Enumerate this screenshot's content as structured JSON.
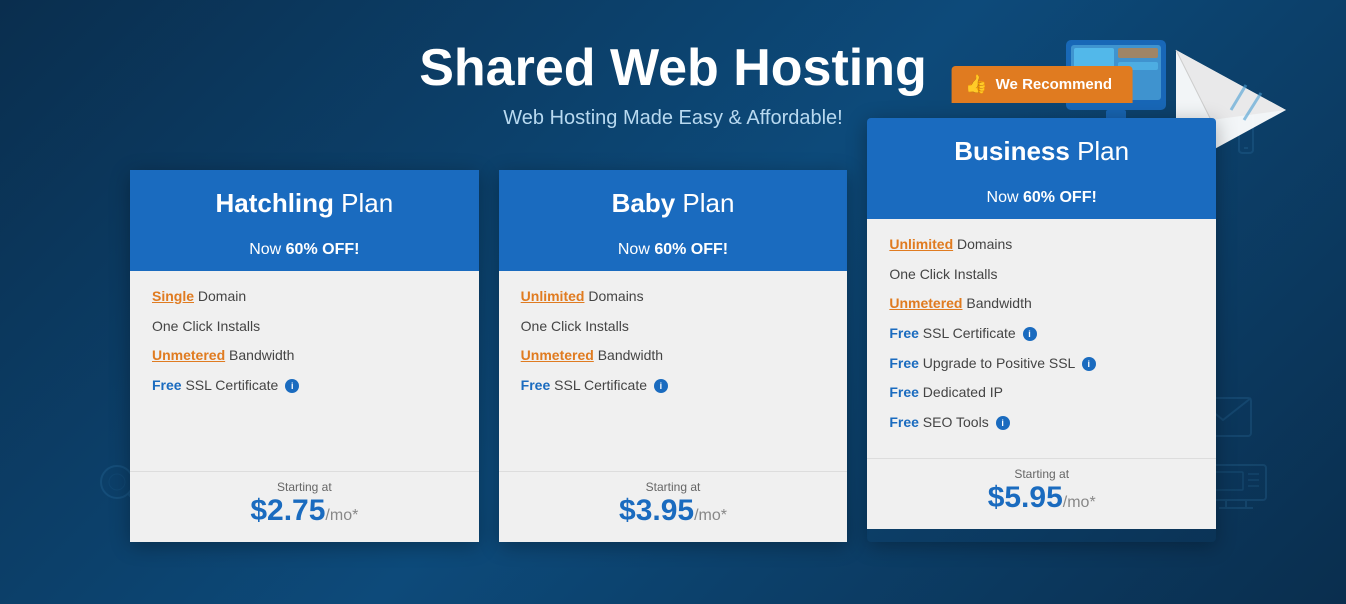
{
  "page": {
    "title": "Shared Web Hosting",
    "subtitle": "Web Hosting Made Easy & Affordable!"
  },
  "plans": [
    {
      "id": "hatchling",
      "name_bold": "Hatchling",
      "name_rest": " Plan",
      "discount_label": "Now ",
      "discount_value": "60% OFF!",
      "features": [
        {
          "highlight": "Single",
          "highlight_type": "orange",
          "rest": " Domain"
        },
        {
          "highlight": "",
          "highlight_type": "none",
          "rest": "One Click Installs"
        },
        {
          "highlight": "Unmetered",
          "highlight_type": "orange",
          "rest": " Bandwidth"
        },
        {
          "highlight": "Free",
          "highlight_type": "blue",
          "rest": " SSL Certificate",
          "info": true
        }
      ],
      "starting_at": "Starting at",
      "price": "$2.75",
      "price_unit": "/mo*"
    },
    {
      "id": "baby",
      "name_bold": "Baby",
      "name_rest": " Plan",
      "discount_label": "Now ",
      "discount_value": "60% OFF!",
      "features": [
        {
          "highlight": "Unlimited",
          "highlight_type": "orange",
          "rest": " Domains"
        },
        {
          "highlight": "",
          "highlight_type": "none",
          "rest": "One Click Installs"
        },
        {
          "highlight": "Unmetered",
          "highlight_type": "orange",
          "rest": " Bandwidth"
        },
        {
          "highlight": "Free",
          "highlight_type": "blue",
          "rest": " SSL Certificate",
          "info": true
        }
      ],
      "starting_at": "Starting at",
      "price": "$3.95",
      "price_unit": "/mo*"
    },
    {
      "id": "business",
      "name_bold": "Business",
      "name_rest": " Plan",
      "discount_label": "Now ",
      "discount_value": "60% OFF!",
      "recommend_label": "We Recommend",
      "features": [
        {
          "highlight": "Unlimited",
          "highlight_type": "orange",
          "rest": " Domains"
        },
        {
          "highlight": "",
          "highlight_type": "none",
          "rest": "One Click Installs"
        },
        {
          "highlight": "Unmetered",
          "highlight_type": "orange",
          "rest": " Bandwidth"
        },
        {
          "highlight": "Free",
          "highlight_type": "blue",
          "rest": " SSL Certificate",
          "info": true
        },
        {
          "highlight": "Free",
          "highlight_type": "blue",
          "rest": " Upgrade to Positive SSL",
          "info": true
        },
        {
          "highlight": "Free",
          "highlight_type": "blue",
          "rest": " Dedicated IP"
        },
        {
          "highlight": "Free",
          "highlight_type": "blue",
          "rest": " SEO Tools",
          "info": true
        }
      ],
      "starting_at": "Starting at",
      "price": "$5.95",
      "price_unit": "/mo*"
    }
  ]
}
